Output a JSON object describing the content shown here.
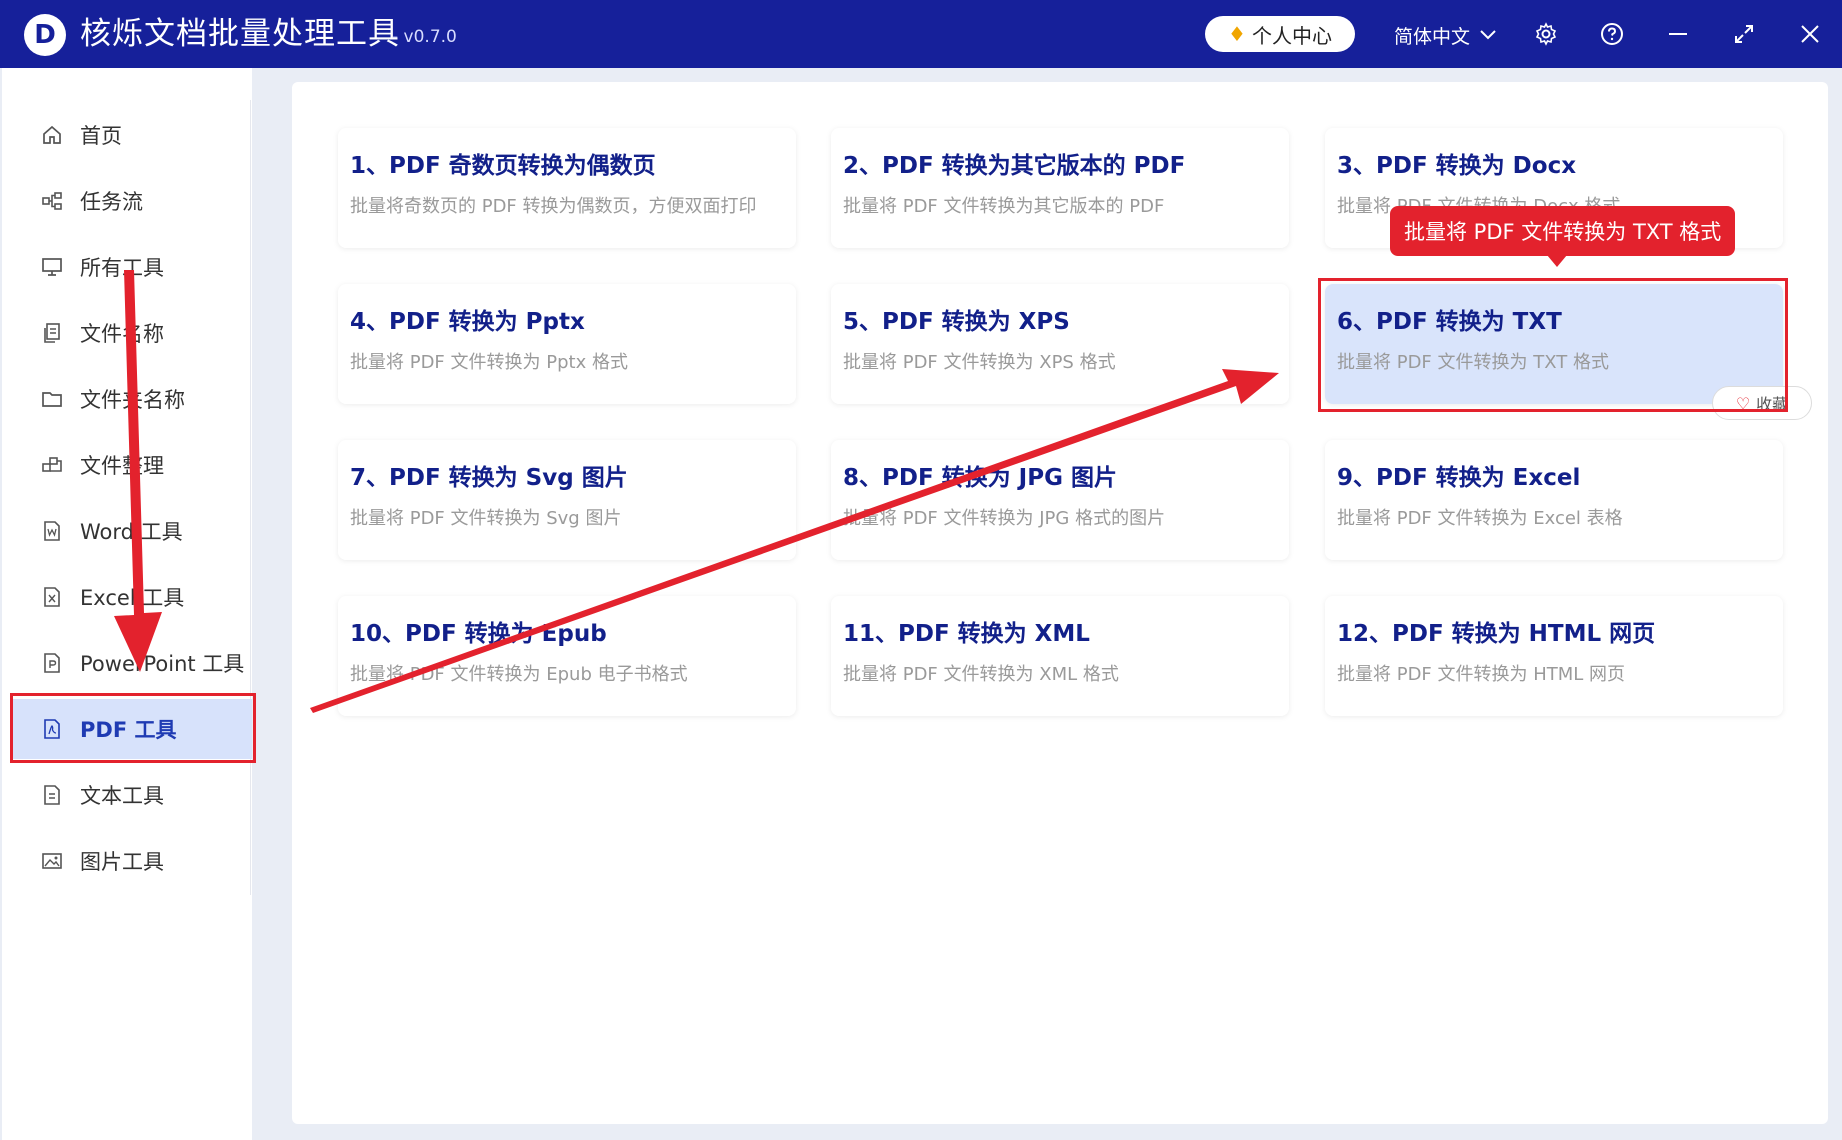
{
  "app": {
    "logo_letter": "D",
    "title": "核烁文档批量处理工具",
    "version": "- v0.7.0",
    "personal_center": "个人中心",
    "language": "简体中文"
  },
  "sidebar": {
    "items": [
      {
        "label": "首页",
        "icon": "home-icon"
      },
      {
        "label": "任务流",
        "icon": "workflow-icon"
      },
      {
        "label": "所有工具",
        "icon": "monitor-icon"
      },
      {
        "label": "文件名称",
        "icon": "file-copy-icon"
      },
      {
        "label": "文件夹名称",
        "icon": "folder-icon"
      },
      {
        "label": "文件整理",
        "icon": "organize-icon"
      },
      {
        "label": "Word 工具",
        "icon": "word-file-icon"
      },
      {
        "label": "Excel 工具",
        "icon": "excel-file-icon"
      },
      {
        "label": "PowerPoint 工具",
        "icon": "ppt-file-icon"
      },
      {
        "label": "PDF 工具",
        "icon": "pdf-file-icon",
        "active": true
      },
      {
        "label": "文本工具",
        "icon": "text-file-icon"
      },
      {
        "label": "图片工具",
        "icon": "image-icon"
      }
    ]
  },
  "tools": [
    {
      "title": "1、PDF 奇数页转换为偶数页",
      "desc": "批量将奇数页的 PDF 转换为偶数页，方便双面打印"
    },
    {
      "title": "2、PDF 转换为其它版本的 PDF",
      "desc": "批量将 PDF 文件转换为其它版本的 PDF"
    },
    {
      "title": "3、PDF 转换为 Docx",
      "desc": "批量将 PDF 文件转换为 Docx 格式"
    },
    {
      "title": "4、PDF 转换为 Pptx",
      "desc": "批量将 PDF 文件转换为 Pptx 格式"
    },
    {
      "title": "5、PDF 转换为 XPS",
      "desc": "批量将 PDF 文件转换为 XPS 格式"
    },
    {
      "title": "6、PDF 转换为 TXT",
      "desc": "批量将 PDF 文件转换为 TXT 格式",
      "selected": true
    },
    {
      "title": "7、PDF 转换为 Svg 图片",
      "desc": "批量将 PDF 文件转换为 Svg 图片"
    },
    {
      "title": "8、PDF 转换为 JPG 图片",
      "desc": "批量将 PDF 文件转换为 JPG 格式的图片"
    },
    {
      "title": "9、PDF 转换为 Excel",
      "desc": "批量将 PDF 文件转换为 Excel 表格"
    },
    {
      "title": "10、PDF 转换为 Epub",
      "desc": "批量将 PDF 文件转换为 Epub 电子书格式"
    },
    {
      "title": "11、PDF 转换为 XML",
      "desc": "批量将 PDF 文件转换为 XML 格式"
    },
    {
      "title": "12、PDF 转换为 HTML 网页",
      "desc": "批量将 PDF 文件转换为 HTML 网页"
    }
  ],
  "favorite_label": "收藏",
  "tooltip": "批量将 PDF 文件转换为 TXT 格式",
  "colors": {
    "titlebar": "#16209a",
    "annotation_red": "#e3222d",
    "selected_card": "#d9e4fb"
  }
}
